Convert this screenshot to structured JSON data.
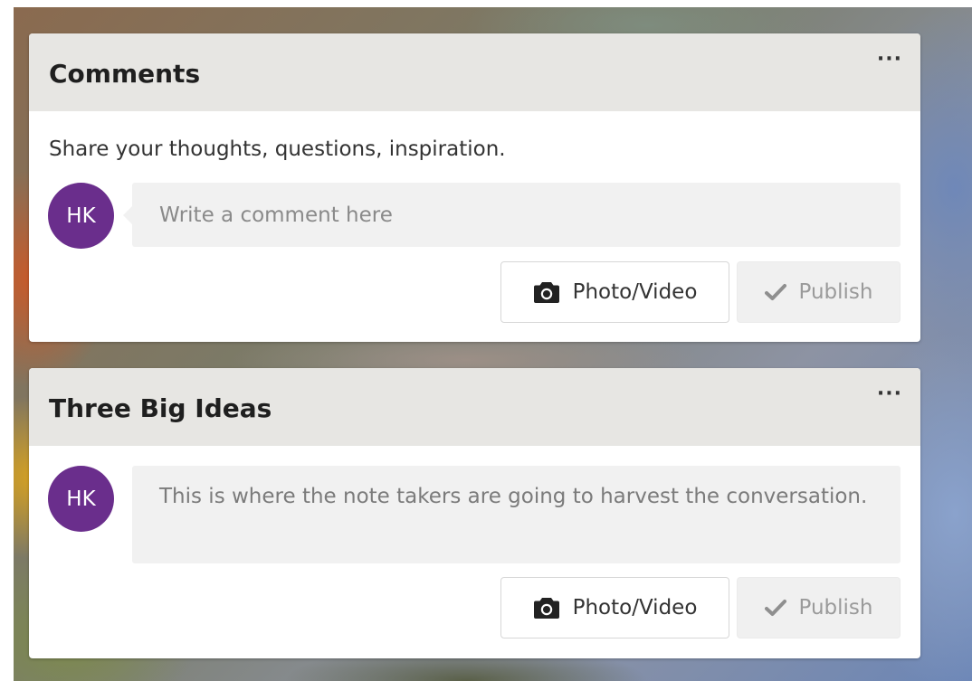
{
  "cards": [
    {
      "title": "Comments",
      "more_label": "···",
      "description": "Share your thoughts, questions, inspiration.",
      "avatar_initials": "HK",
      "comment_placeholder": "Write a comment here",
      "photo_button_label": "Photo/Video",
      "publish_button_label": "Publish"
    },
    {
      "title": "Three Big Ideas",
      "more_label": "···",
      "avatar_initials": "HK",
      "comment_text": "This is where the note takers are going to harvest the conversation.",
      "photo_button_label": "Photo/Video",
      "publish_button_label": "Publish"
    }
  ],
  "colors": {
    "avatar": "#6a2e8c",
    "header_bg": "#e7e6e3",
    "input_bg": "#f1f1f1"
  },
  "icons": [
    "more-icon",
    "camera-icon",
    "check-icon"
  ]
}
